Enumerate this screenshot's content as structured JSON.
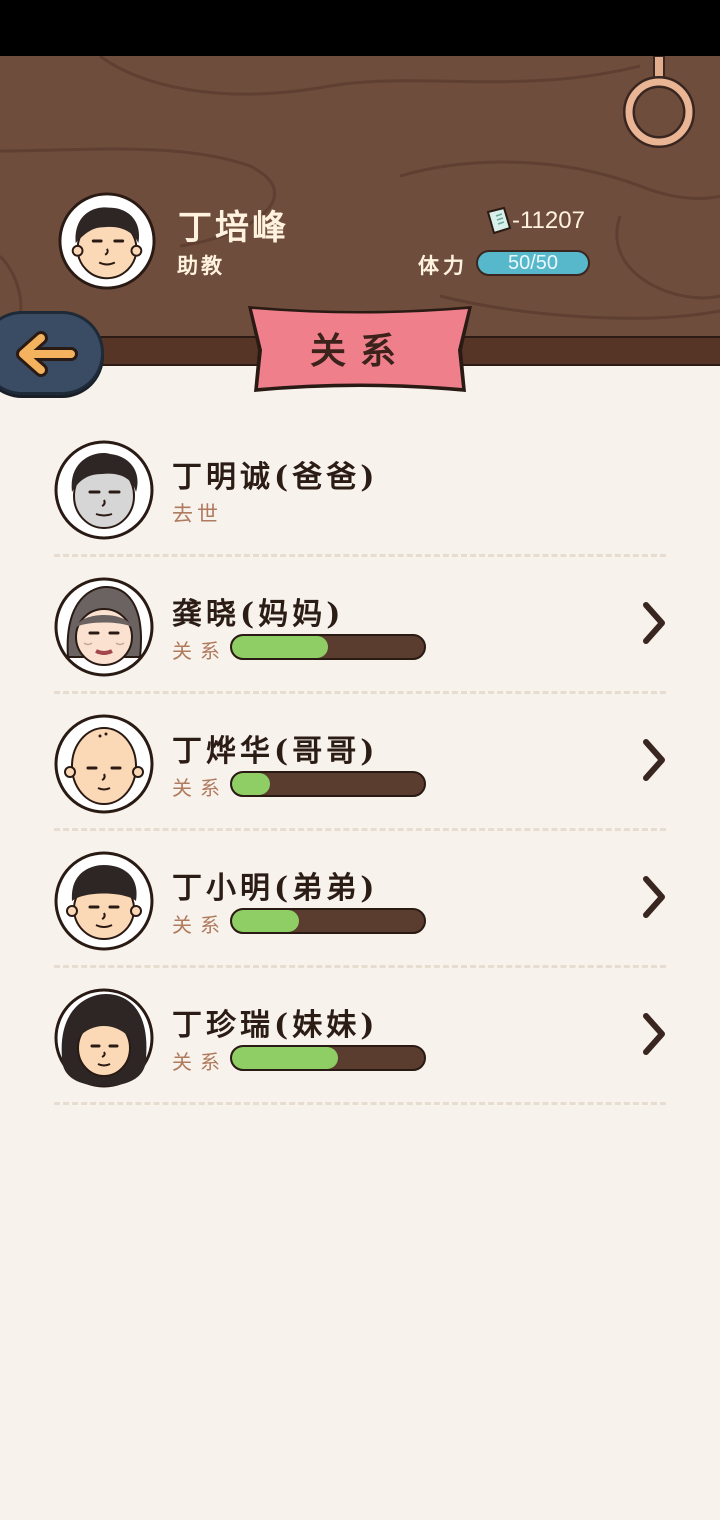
{
  "player": {
    "name": "丁培峰",
    "title": "助教",
    "money": "-11207",
    "stamina_label": "体力",
    "stamina": "50/50"
  },
  "page": {
    "title": "关系"
  },
  "relations": [
    {
      "name": "丁明诚(爸爸)",
      "status": "去世",
      "avatar": "father-avatar"
    },
    {
      "name": "龚晓(妈妈)",
      "label": "关系",
      "level": 0.5,
      "avatar": "mother-avatar"
    },
    {
      "name": "丁烨华(哥哥)",
      "label": "关系",
      "level": 0.2,
      "avatar": "brother-avatar"
    },
    {
      "name": "丁小明(弟弟)",
      "label": "关系",
      "level": 0.35,
      "avatar": "younger-brother-avatar"
    },
    {
      "name": "丁珍瑞(妹妹)",
      "label": "关系",
      "level": 0.55,
      "avatar": "sister-avatar"
    }
  ],
  "colors": {
    "wood": "#6f4d3c",
    "banner": "#f07f8c",
    "stamina": "#58b8cb",
    "relation_fill": "#8fce64",
    "relation_track": "#5b3d30",
    "back_button": "#3a4c64",
    "back_arrow": "#f4b25e"
  },
  "icons": {
    "back": "back-arrow-icon",
    "money": "money-note-icon",
    "row_action": "chevron-right-icon",
    "hanging_ring": "ring-icon"
  }
}
